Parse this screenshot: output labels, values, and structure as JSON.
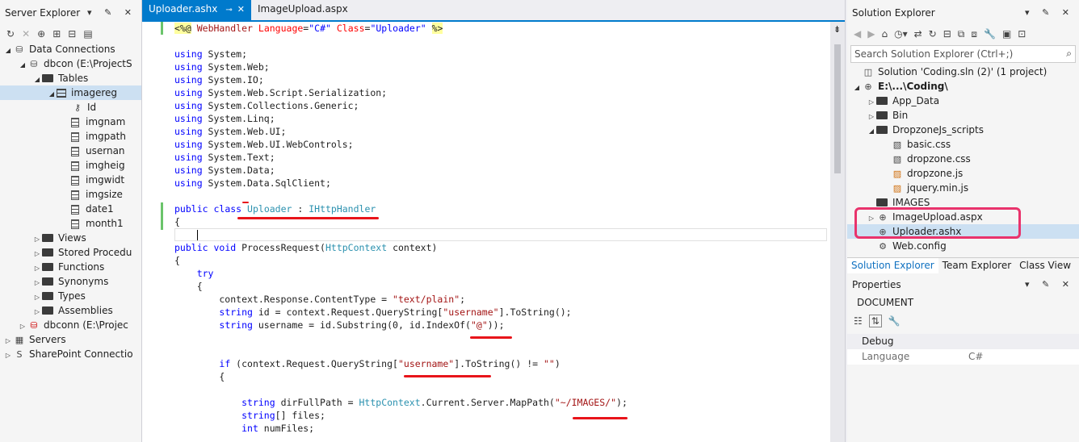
{
  "server_explorer": {
    "title": "Server Explorer",
    "title_icons": "▾ ✎ ✕",
    "tree": [
      {
        "label": "Data Connections",
        "level": 0,
        "arrow": "◢",
        "icon": "data-connections-icon"
      },
      {
        "label": "dbcon (E:\\ProjectS",
        "level": 1,
        "arrow": "◢",
        "icon": "database-icon"
      },
      {
        "label": "Tables",
        "level": 2,
        "arrow": "◢",
        "icon": "folder-icon"
      },
      {
        "label": "imagereg",
        "level": 3,
        "arrow": "◢",
        "icon": "table-icon",
        "selected": true
      },
      {
        "label": "Id",
        "level": 4,
        "icon": "key-icon"
      },
      {
        "label": "imgnam",
        "level": 4,
        "icon": "column-icon"
      },
      {
        "label": "imgpath",
        "level": 4,
        "icon": "column-icon"
      },
      {
        "label": "usernan",
        "level": 4,
        "icon": "column-icon"
      },
      {
        "label": "imgheig",
        "level": 4,
        "icon": "column-icon"
      },
      {
        "label": "imgwidt",
        "level": 4,
        "icon": "column-icon"
      },
      {
        "label": "imgsize",
        "level": 4,
        "icon": "column-icon"
      },
      {
        "label": "date1",
        "level": 4,
        "icon": "column-icon"
      },
      {
        "label": "month1",
        "level": 4,
        "icon": "column-icon"
      },
      {
        "label": "Views",
        "level": 2,
        "arrow": "▷",
        "icon": "folder-icon"
      },
      {
        "label": "Stored Procedu",
        "level": 2,
        "arrow": "▷",
        "icon": "folder-icon"
      },
      {
        "label": "Functions",
        "level": 2,
        "arrow": "▷",
        "icon": "folder-icon"
      },
      {
        "label": "Synonyms",
        "level": 2,
        "arrow": "▷",
        "icon": "folder-icon"
      },
      {
        "label": "Types",
        "level": 2,
        "arrow": "▷",
        "icon": "folder-icon"
      },
      {
        "label": "Assemblies",
        "level": 2,
        "arrow": "▷",
        "icon": "folder-icon"
      },
      {
        "label": "dbconn (E:\\Projec",
        "level": 1,
        "arrow": "▷",
        "icon": "database-error-icon"
      },
      {
        "label": "Servers",
        "level": 0,
        "arrow": "▷",
        "icon": "servers-icon"
      },
      {
        "label": "SharePoint Connectio",
        "level": 0,
        "arrow": "▷",
        "icon": "sharepoint-icon"
      }
    ]
  },
  "editor": {
    "tabs": [
      {
        "label": "Uploader.ashx",
        "active": true,
        "pin": "⊸",
        "close": "✕"
      },
      {
        "label": "ImageUpload.aspx",
        "active": false
      }
    ],
    "lines": [
      {
        "y": 0,
        "html": "<span class=\"hl\">&lt;%@</span> <span class=\"st\">WebHandler</span> <span class=\"at\">Language</span>=<span class=\"kw\">\"C#\"</span> <span class=\"at\">Class</span>=<span class=\"kw\">\"Uploader\"</span> <span class=\"hl\">%&gt;</span>"
      },
      {
        "y": 2,
        "html": "<span class=\"kw\">using</span> System;"
      },
      {
        "y": 3,
        "html": "<span class=\"kw\">using</span> System.Web;"
      },
      {
        "y": 4,
        "html": "<span class=\"kw\">using</span> System.IO;"
      },
      {
        "y": 5,
        "html": "<span class=\"kw\">using</span> System.Web.Script.Serialization;"
      },
      {
        "y": 6,
        "html": "<span class=\"kw\">using</span> System.Collections.Generic;"
      },
      {
        "y": 7,
        "html": "<span class=\"kw\">using</span> System.Linq;"
      },
      {
        "y": 8,
        "html": "<span class=\"kw\">using</span> System.Web.UI;"
      },
      {
        "y": 9,
        "html": "<span class=\"kw\">using</span> System.Web.UI.WebControls;"
      },
      {
        "y": 10,
        "html": "<span class=\"kw\">using</span> System.Text;"
      },
      {
        "y": 11,
        "html": "<span class=\"kw\">using</span> System.Data;"
      },
      {
        "y": 12,
        "html": "<span class=\"kw\">using</span> System.Data.SqlClient;"
      },
      {
        "y": 14,
        "html": "<span class=\"kw\">public</span> <span class=\"kw\">class</span> <span class=\"ty\">Uploader</span> : <span class=\"ty\">IHttpHandler</span>"
      },
      {
        "y": 15,
        "html": "{"
      },
      {
        "y": 17,
        "html": "<span class=\"kw\">public</span> <span class=\"kw\">void</span> ProcessRequest(<span class=\"ty\">HttpContext</span> context)"
      },
      {
        "y": 18,
        "html": "{"
      },
      {
        "y": 19,
        "html": "    <span class=\"kw\">try</span>"
      },
      {
        "y": 20,
        "html": "    {"
      },
      {
        "y": 21,
        "html": "        context.Response.ContentType = <span class=\"st\">\"text/plain\"</span>;"
      },
      {
        "y": 22,
        "html": "        <span class=\"kw\">string</span> id = context.Request.QueryString[<span class=\"st\">\"username\"</span>].ToString();"
      },
      {
        "y": 23,
        "html": "        <span class=\"kw\">string</span> username = id.Substring(0, id.IndexOf(<span class=\"st\">\"@\"</span>));"
      },
      {
        "y": 26,
        "html": "        <span class=\"kw\">if</span> (context.Request.QueryString[<span class=\"st\">\"username\"</span>].ToString() != <span class=\"st\">\"\"</span>)"
      },
      {
        "y": 27,
        "html": "        {"
      },
      {
        "y": 29,
        "html": "            <span class=\"kw\">string</span> dirFullPath = <span class=\"ty\">HttpContext</span>.Current.Server.MapPath(<span class=\"st\">\"~/IMAGES/\"</span>);"
      },
      {
        "y": 30,
        "html": "            <span class=\"kw\">string</span>[] files;"
      },
      {
        "y": 31,
        "html": "            <span class=\"kw\">int</span> numFiles;"
      }
    ]
  },
  "solution_explorer": {
    "title": "Solution Explorer",
    "title_icons": "▾ ✎ ✕",
    "search_placeholder": "Search Solution Explorer (Ctrl+;)",
    "tree": [
      {
        "label": "Solution 'Coding.sln (2)' (1 project)",
        "level": 0,
        "icon": "solution-icon"
      },
      {
        "label": "E:\\...\\Coding\\",
        "level": 0,
        "arrow": "◢",
        "icon": "globe-icon",
        "bold": true
      },
      {
        "label": "App_Data",
        "level": 1,
        "arrow": "▷",
        "icon": "folder-icon"
      },
      {
        "label": "Bin",
        "level": 1,
        "arrow": "▷",
        "icon": "folder-icon"
      },
      {
        "label": "DropzoneJs_scripts",
        "level": 1,
        "arrow": "◢",
        "icon": "folder-icon"
      },
      {
        "label": "basic.css",
        "level": 2,
        "icon": "css-file-icon"
      },
      {
        "label": "dropzone.css",
        "level": 2,
        "icon": "css-file-icon"
      },
      {
        "label": "dropzone.js",
        "level": 2,
        "icon": "js-file-icon"
      },
      {
        "label": "jquery.min.js",
        "level": 2,
        "icon": "js-file-icon"
      },
      {
        "label": "IMAGES",
        "level": 1,
        "icon": "folder-icon"
      },
      {
        "label": "ImageUpload.aspx",
        "level": 1,
        "arrow": "▷",
        "icon": "aspx-file-icon"
      },
      {
        "label": "Uploader.ashx",
        "level": 1,
        "icon": "ashx-file-icon",
        "selected": true
      },
      {
        "label": "Web.config",
        "level": 1,
        "icon": "config-file-icon"
      }
    ],
    "bottom_tabs": [
      "Solution Explorer",
      "Team Explorer",
      "Class View"
    ]
  },
  "properties": {
    "title": "Properties",
    "title_icons": "▾ ✎ ✕",
    "object": "DOCUMENT",
    "category": "Debug",
    "rows": [
      {
        "name": "Language",
        "value": "C#"
      }
    ]
  },
  "colors": {
    "accent": "#007acc",
    "annotation": "#e8141a",
    "highlight_box": "#e9336c"
  }
}
